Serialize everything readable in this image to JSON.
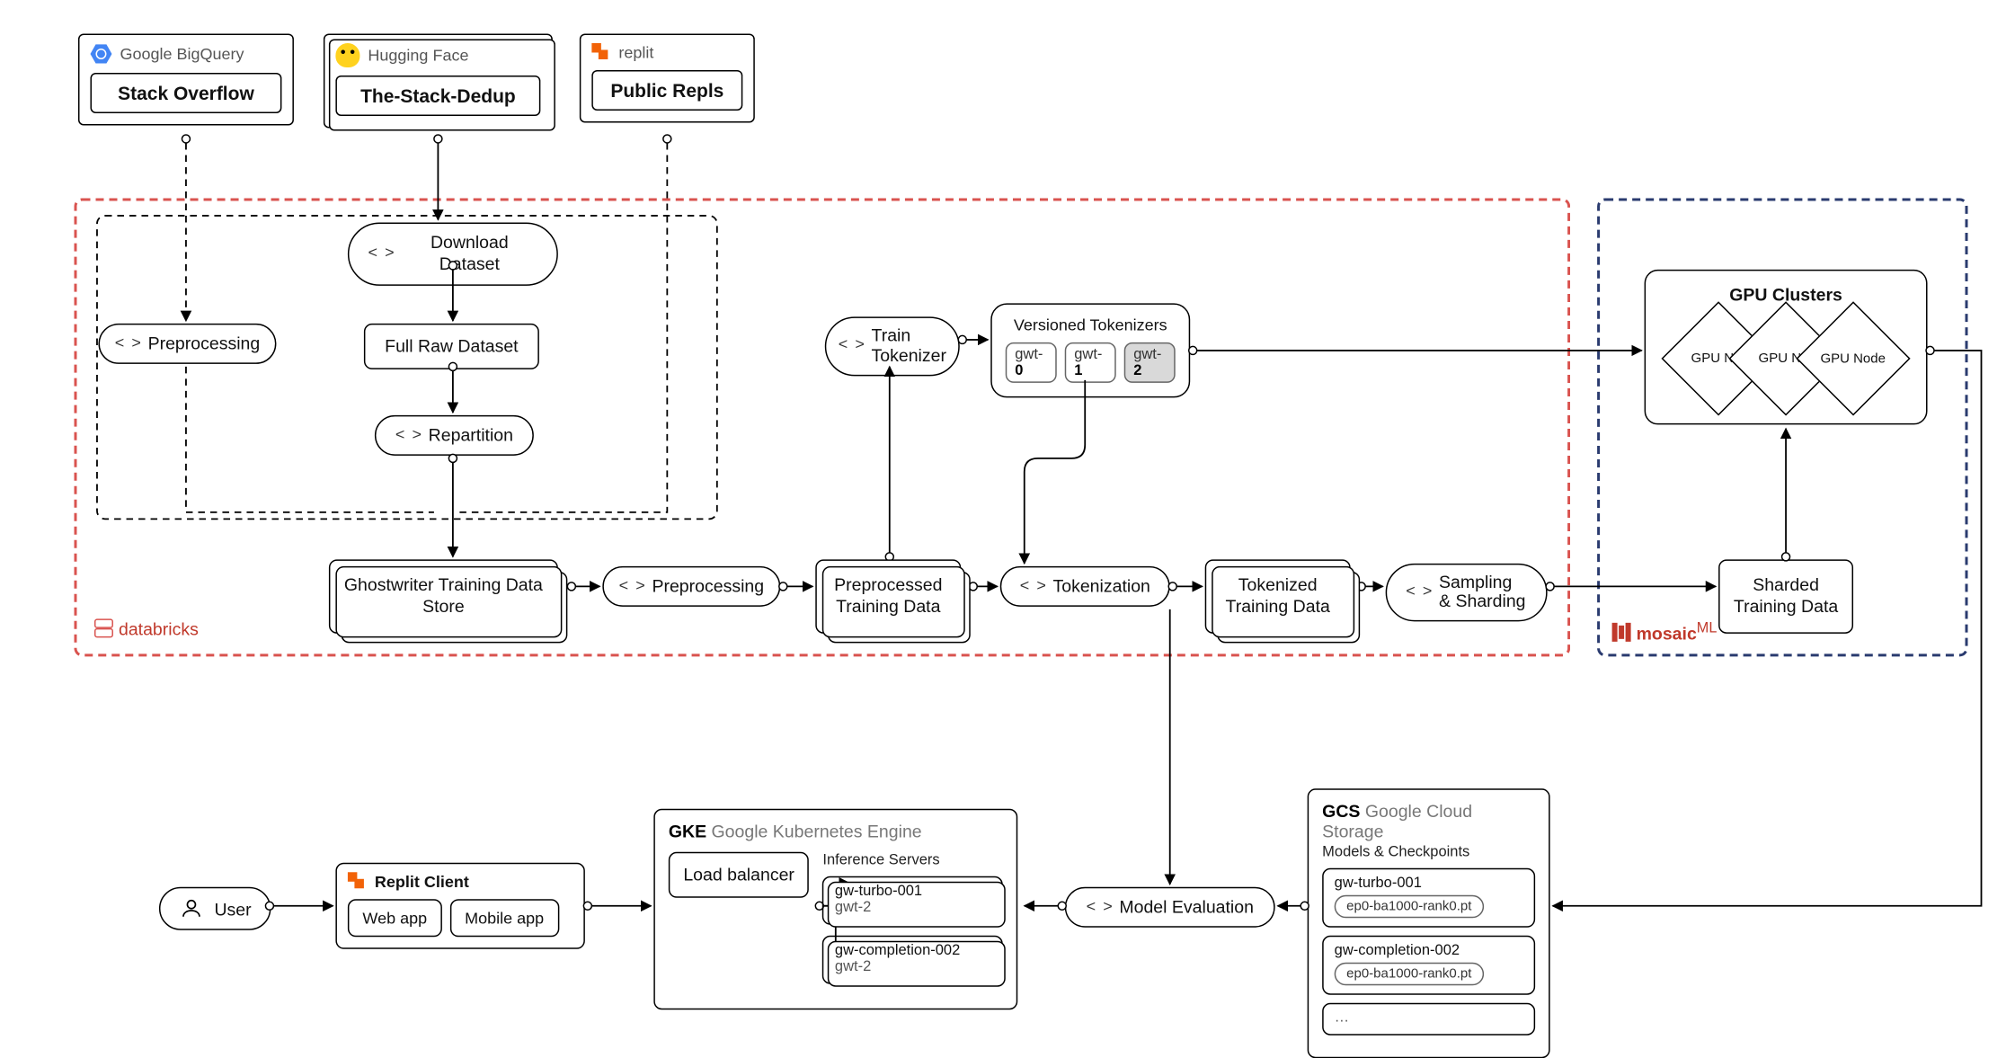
{
  "sources": {
    "bigquery": {
      "brand": "Google BigQuery",
      "dataset": "Stack Overflow"
    },
    "huggingface": {
      "brand": "Hugging Face",
      "dataset": "The-Stack-Dedup"
    },
    "replit": {
      "brand": "replit",
      "dataset": "Public Repls"
    }
  },
  "steps": {
    "download": "Download Dataset",
    "full_raw": "Full Raw Dataset",
    "repartition": "Repartition",
    "preprocessing_left": "Preprocessing",
    "ghostwriter": "Ghostwriter Training Data Store",
    "preprocessing": "Preprocessing",
    "preprocessed": "Preprocessed Training Data",
    "train_tokenizer": "Train Tokenizer",
    "tokenization": "Tokenization",
    "tokenized": "Tokenized Training Data",
    "sampling": "Sampling & Sharding",
    "sharded": "Sharded Training Data",
    "model_eval": "Model Evaluation"
  },
  "tokenizers": {
    "title": "Versioned Tokenizers",
    "items": [
      {
        "prefix": "gwt-",
        "ver": "0"
      },
      {
        "prefix": "gwt-",
        "ver": "1"
      },
      {
        "prefix": "gwt-",
        "ver": "2"
      }
    ]
  },
  "gpu": {
    "title": "GPU Clusters",
    "nodes": [
      "GPU No.",
      "GPU No.",
      "GPU Node"
    ]
  },
  "regions": {
    "databricks": "databricks",
    "mosaic": "mosaic",
    "mosaic_suffix": "ML"
  },
  "gcs": {
    "abbr": "GCS",
    "full": "Google Cloud Storage",
    "subtitle": "Models & Checkpoints",
    "models": [
      {
        "name": "gw-turbo-001",
        "ckpt": "ep0-ba1000-rank0.pt"
      },
      {
        "name": "gw-completion-002",
        "ckpt": "ep0-ba1000-rank0.pt"
      }
    ],
    "more": "…"
  },
  "gke": {
    "abbr": "GKE",
    "full": "Google Kubernetes Engine",
    "subtitle": "Inference Servers",
    "load_balancer": "Load balancer",
    "servers": [
      {
        "name": "gw-turbo-001",
        "tok": "gwt-2"
      },
      {
        "name": "gw-completion-002",
        "tok": "gwt-2"
      }
    ]
  },
  "client": {
    "title": "Replit Client",
    "web": "Web app",
    "mobile": "Mobile app"
  },
  "user": "User"
}
